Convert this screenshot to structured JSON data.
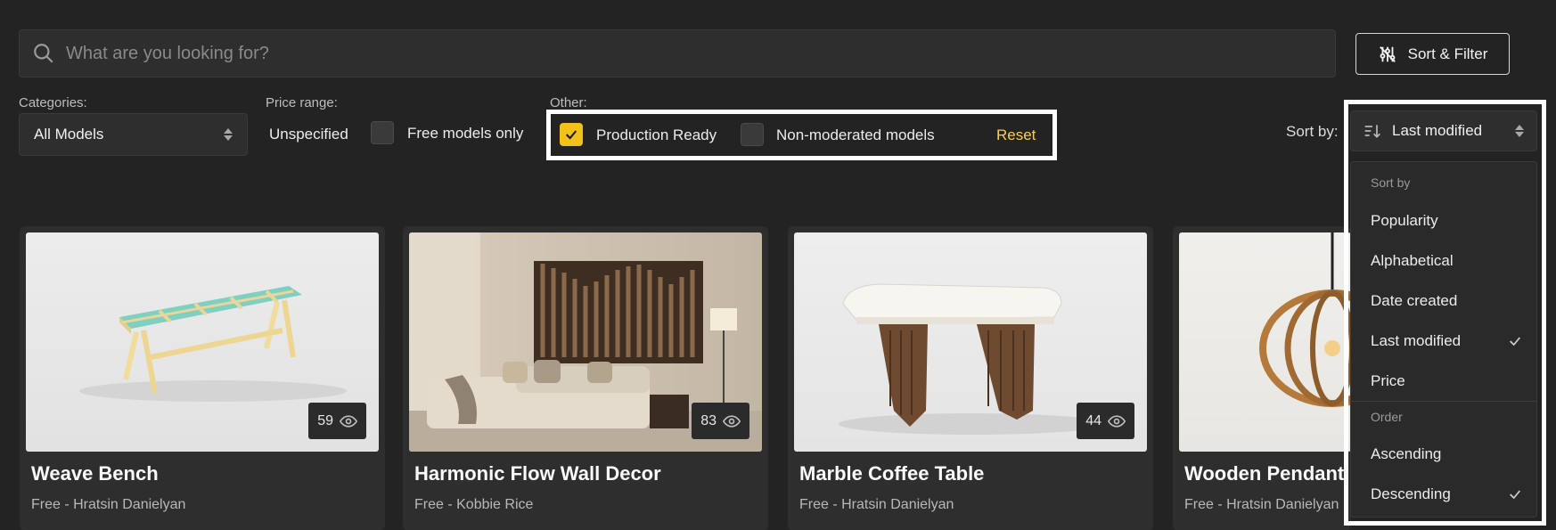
{
  "search": {
    "placeholder": "What are you looking for?"
  },
  "toolbar": {
    "sort_filter_label": "Sort & Filter"
  },
  "filters": {
    "categories_label": "Categories:",
    "categories_value": "All Models",
    "price_label": "Price range:",
    "price_value": "Unspecified",
    "free_only_label": "Free models only",
    "free_only_checked": false,
    "other_label": "Other:",
    "production_ready_label": "Production Ready",
    "production_ready_checked": true,
    "non_moderated_label": "Non-moderated models",
    "non_moderated_checked": false,
    "reset_label": "Reset"
  },
  "sort": {
    "label": "Sort by:",
    "value": "Last modified",
    "menu": {
      "section_sort": "Sort by",
      "sort_items": [
        "Popularity",
        "Alphabetical",
        "Date created",
        "Last modified",
        "Price"
      ],
      "selected_sort": "Last modified",
      "section_order": "Order",
      "order_items": [
        "Ascending",
        "Descending"
      ],
      "selected_order": "Descending"
    }
  },
  "cards": [
    {
      "title": "Weave Bench",
      "subtitle": "Free - Hratsin Danielyan",
      "views": "59"
    },
    {
      "title": "Harmonic Flow Wall Decor",
      "subtitle": "Free - Kobbie Rice",
      "views": "83"
    },
    {
      "title": "Marble Coffee Table",
      "subtitle": "Free - Hratsin Danielyan",
      "views": "44"
    },
    {
      "title": "Wooden Pendant",
      "subtitle": "Free - Hratsin Danielyan",
      "views": ""
    }
  ],
  "colors": {
    "accent": "#f2c21b",
    "reset": "#f6d04d",
    "background": "#232323",
    "card": "#2e2e2e"
  }
}
